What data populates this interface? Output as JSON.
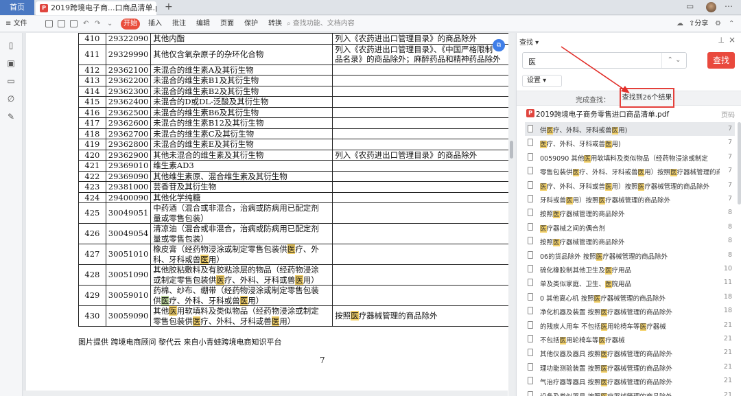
{
  "titlebar": {
    "home_tab": "首页",
    "doc_tab": "2019跨境电子商...口商品清单.pdf",
    "close": "×",
    "new_tab": "+"
  },
  "toolbar": {
    "menu": "≡ 文件",
    "start": "开始",
    "items": [
      "插入",
      "批注",
      "编辑",
      "页面",
      "保护",
      "转换"
    ],
    "search_placeholder": "查找功能、文档内容",
    "share": "分享"
  },
  "table": {
    "rows": [
      {
        "no": "410",
        "code": "29322090",
        "name": "其他内酯",
        "note": "列入《农药进出口管理目录》的商品除外"
      },
      {
        "no": "411",
        "code": "29329990",
        "name": "其他仅含氧杂原子的杂环化合物",
        "note": "列入《农药进出口管理目录》、《中国严格限制",
        "note2": "品名录》的商品除外；麻醉药品和精神药品除外"
      },
      {
        "no": "412",
        "code": "29362100",
        "name": "未混合的维生素A及其衍生物",
        "note": ""
      },
      {
        "no": "413",
        "code": "29362200",
        "name": "未混合的维生素B1及其衍生物",
        "note": ""
      },
      {
        "no": "414",
        "code": "29362300",
        "name": "未混合的维生素B2及其衍生物",
        "note": ""
      },
      {
        "no": "415",
        "code": "29362400",
        "name": "未混合的D或DL-泛酸及其衍生物",
        "note": ""
      },
      {
        "no": "416",
        "code": "29362500",
        "name": "未混合的维生素B6及其衍生物",
        "note": ""
      },
      {
        "no": "417",
        "code": "29362600",
        "name": "未混合的维生素B12及其衍生物",
        "note": ""
      },
      {
        "no": "418",
        "code": "29362700",
        "name": "未混合的维生素C及其衍生物",
        "note": ""
      },
      {
        "no": "419",
        "code": "29362800",
        "name": "未混合的维生素E及其衍生物",
        "note": ""
      },
      {
        "no": "420",
        "code": "29362900",
        "name": "其他未混合的维生素及其衍生物",
        "note": "列入《农药进出口管理目录》的商品除外"
      },
      {
        "no": "421",
        "code": "29369010",
        "name": "维生素AD3",
        "note": ""
      },
      {
        "no": "422",
        "code": "29369090",
        "name": "其他维生素原、混合维生素及其衍生物",
        "note": ""
      },
      {
        "no": "423",
        "code": "29381000",
        "name": "芸香苷及其衍生物",
        "note": ""
      },
      {
        "no": "424",
        "code": "29400090",
        "name": "其他化学纯糖",
        "note": ""
      }
    ],
    "row425": {
      "no": "425",
      "code": "30049051",
      "l1": "中药酒（混合或非混合，治病或防病用已配定剂",
      "l2": "量或零售包装）"
    },
    "row426": {
      "no": "426",
      "code": "30049054",
      "l1": "清凉油（混合或非混合，治病或防病用已配定剂",
      "l2": "量或零售包装）"
    },
    "row427": {
      "no": "427",
      "code": "30051010",
      "l1a": "橡皮膏（经药物浸涂或制定零售包装供",
      "hl": "医",
      "l1b": "疗、外",
      "l2a": "科、牙科或兽",
      "l2b": "用）"
    },
    "row428": {
      "no": "428",
      "code": "30051090",
      "l1": "其他胶粘敷料及有胶粘涂层的物品（经药物浸涂",
      "l2a": "或制定零售包装供",
      "hl": "医",
      "l2b": "疗、外科、牙科或兽",
      "l2c": "用）"
    },
    "row429": {
      "no": "429",
      "code": "30059010",
      "l1": "药棉、纱布、绷带（经药物浸涂或制定零售包装",
      "l2a": "供",
      "hl": "医",
      "l2b": "疗、外科、牙科或兽",
      "l2c": "用）"
    },
    "row430": {
      "no": "430",
      "code": "30059090",
      "l1a": "其他",
      "hl": "医",
      "l1b": "用软填料及类似物品（经药物浸涂或制定",
      "l2a": "零售包装供",
      "l2b": "疗、外科、牙科或兽",
      "l2c": "用）",
      "note_a": "按照",
      "note_b": "疗器械管理的商品除外"
    },
    "caption": "图片提供 跨境电商顾问 黎代云 来自小青蛙跨境电商知识平台",
    "page_number": "7"
  },
  "panel": {
    "title": "查找 ▾",
    "query": "医",
    "find_button": "查找",
    "settings": "设置 ▾",
    "done_text": "完成查找：",
    "result_count": "查找到26个结果",
    "file_name": "2019跨境电子商务零售进口商品清单.pdf",
    "page_header": "页码",
    "results": [
      {
        "text": "供医疗、外科、牙科或兽医用)",
        "page": "7"
      },
      {
        "text": "医疗、外科、牙科或兽医用)",
        "page": "7"
      },
      {
        "text": "0059090 其他医用软填料及类似物品（经药物浸涂或制定",
        "page": "7"
      },
      {
        "text": "零售包装供医疗、外科、牙科或兽医用）按照医疗器械管理的商",
        "page": "7"
      },
      {
        "text": "医疗、外科、牙科或兽医用）按照医疗器械管理的商品除外",
        "page": "7"
      },
      {
        "text": "牙科或兽医用）按照医疗器械管理的商品除外",
        "page": "7"
      },
      {
        "text": "按照医疗器械管理的商品除外",
        "page": "8"
      },
      {
        "text": "医疗器械之间的偶合剂",
        "page": "8"
      },
      {
        "text": "按照医疗器械管理的商品除外",
        "page": "8"
      },
      {
        "text": "06的货品除外 按照医疗器械管理的商品除外",
        "page": "8"
      },
      {
        "text": "硫化橡胶制其他卫生及医疗用品",
        "page": "10"
      },
      {
        "text": "单及类似家庭、卫生、医院用品",
        "page": "11"
      },
      {
        "text": "0 其他离心机 按照医疗器械管理的商品除外",
        "page": "18"
      },
      {
        "text": "净化机器及装置 按照医疗器械管理的商品除外",
        "page": "18"
      },
      {
        "text": "的残疾人用车 不包括医用轮椅车等医疗器械",
        "page": "21"
      },
      {
        "text": "不包括医用轮椅车等医疗器械",
        "page": "21"
      },
      {
        "text": "其他仪器及器具 按照医疗器械管理的商品除外",
        "page": "21"
      },
      {
        "text": "理功能测验装置 按照医疗器械管理的商品除外",
        "page": "21"
      },
      {
        "text": "气治疗器等器具 按照医疗器械管理的商品除外",
        "page": "21"
      },
      {
        "text": "设备及类似器具 按照医疗器械管理的商品除外",
        "page": "21"
      }
    ]
  }
}
